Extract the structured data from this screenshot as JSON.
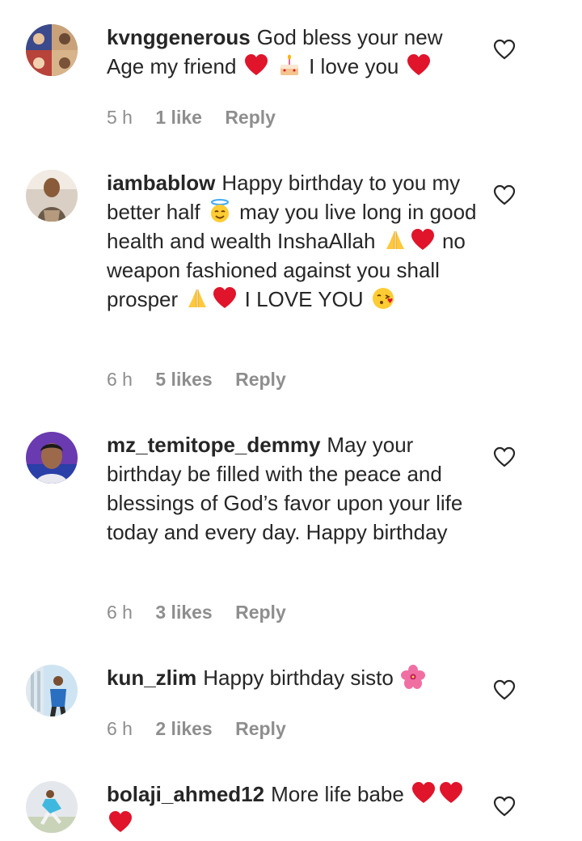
{
  "comments": [
    {
      "username": "kvnggenerous",
      "text_parts": [
        "God bless your new Age my friend",
        "I love you"
      ],
      "time": "5 h",
      "likes": "1 like",
      "reply": "Reply"
    },
    {
      "username": "iambablow",
      "text_parts": [
        "Happy birthday to you my better half",
        "may you live long in good health and wealth InshaAllah",
        "no weapon fashioned against you shall prosper",
        "I LOVE YOU"
      ],
      "time": "6 h",
      "likes": "5 likes",
      "reply": "Reply"
    },
    {
      "username": "mz_temitope_demmy",
      "text_parts": [
        "May your birthday be filled with the peace and blessings of God’s favor upon your life today and every day. Happy birthday"
      ],
      "time": "6 h",
      "likes": "3 likes",
      "reply": "Reply"
    },
    {
      "username": "kun_zlim",
      "text_parts": [
        "Happy birthday sisto"
      ],
      "time": "6 h",
      "likes": "2 likes",
      "reply": "Reply"
    },
    {
      "username": "bolaji_ahmed12",
      "text_parts": [
        "More life babe"
      ],
      "time": "",
      "likes": "",
      "reply": ""
    }
  ],
  "icons": {
    "like": "heart-outline-icon",
    "red_heart": "red-heart-emoji",
    "cake": "birthday-cake-emoji",
    "halo": "smiling-face-with-halo-emoji",
    "pray": "folded-hands-emoji",
    "kiss": "face-blowing-kiss-emoji",
    "flower": "hibiscus-emoji"
  },
  "colors": {
    "text": "#262626",
    "meta": "#8e8e8e",
    "heart_red": "#e0142b"
  }
}
